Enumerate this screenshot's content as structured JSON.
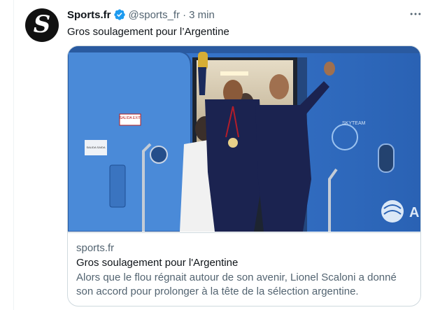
{
  "tweet": {
    "display_name": "Sports.fr",
    "handle": "@sports_fr",
    "separator": "·",
    "time": "3 min",
    "text": "Gros soulagement pour l’Argentine",
    "avatar_letter": "S",
    "verified_color": "#1d9bf0",
    "more_icon": "more-horizontal-icon"
  },
  "card": {
    "domain": "sports.fr",
    "title": "Gros soulagement pour l'Argentine",
    "description": "Alors que le flou régnait autour de son avenir, Lionel Scaloni a donné son accord pour prolonger à la tête de la sélection argentine.",
    "image_sign_text": "SALIDA EXIT",
    "image_placard_text": "SALIDA SAIDA",
    "image_livery_text": "SKYTEAM",
    "image_tail_text": "A"
  },
  "colors": {
    "text_primary": "#0f1419",
    "text_secondary": "#536471",
    "border": "#cfd9de",
    "accent": "#1d9bf0",
    "plane_blue": "#2f6fc4"
  }
}
